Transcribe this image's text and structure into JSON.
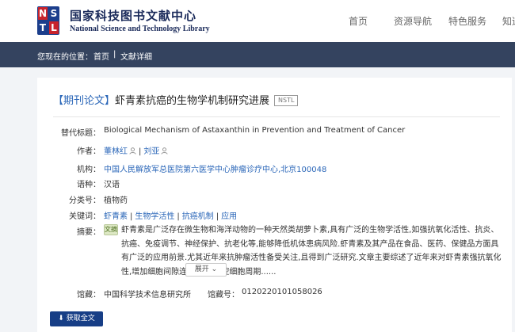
{
  "header": {
    "logo_letters": [
      "N",
      "S",
      "T",
      "L"
    ],
    "title_cn": "国家科技图书文献中心",
    "title_en": "National Science and Technology Library",
    "nav": [
      "首页",
      "资源导航",
      "特色服务",
      "知道"
    ]
  },
  "breadcrumb": {
    "prefix": "您现在的位置：",
    "home": "首页",
    "separator": "|",
    "current": "文献详细"
  },
  "article": {
    "type": "【期刊论文】",
    "title": "虾青素抗癌的生物学机制研究进展",
    "badge": "NSTL",
    "fields": {
      "alt_title_label": "替代标题：",
      "alt_title": "Biological Mechanism of Astaxanthin in Prevention and Treatment of Cancer",
      "authors_label": "作者：",
      "authors": [
        "董林红",
        "刘亚"
      ],
      "org_label": "机构：",
      "org": "中国人民解放军总医院第六医学中心肿瘤诊疗中心,北京100048",
      "lang_label": "语种：",
      "lang": "汉语",
      "class_label": "分类号：",
      "class": "植物药",
      "keywords_label": "关键词：",
      "keywords": [
        "虾青素",
        "生物学活性",
        "抗癌机制",
        "应用"
      ],
      "abstract_label": "摘要：",
      "abstract_icon": "文摘",
      "abstract": "虾青素是广泛存在微生物和海洋动物的一种天然类胡萝卜素,具有广泛的生物学活性,如强抗氧化活性、抗炎、抗癌、免疫调节、神经保护、抗老化等,能够降低机体患病风险.虾青素及其产品在食品、医药、保健品方面具有广泛的应用前景.尤其近年来抗肿瘤活性备受关注,且得到广泛研究.文章主要综述了近年来对虾青素强抗氧化性,增加细胞间隙连接通讯,调控细胞周期......",
      "expand_label": "展开",
      "library_label": "馆藏：",
      "library": "中国科学技术信息研究所",
      "call_no_label": "馆藏号：",
      "call_no": "0120220101058026"
    },
    "get_fulltext": "获取全文"
  },
  "colors": {
    "brand_blue": "#1b3e8c",
    "logo_red": "#c8232c",
    "link_blue": "#2a66b8",
    "crumb_bar": "#34435f",
    "button_blue": "#173e86"
  }
}
